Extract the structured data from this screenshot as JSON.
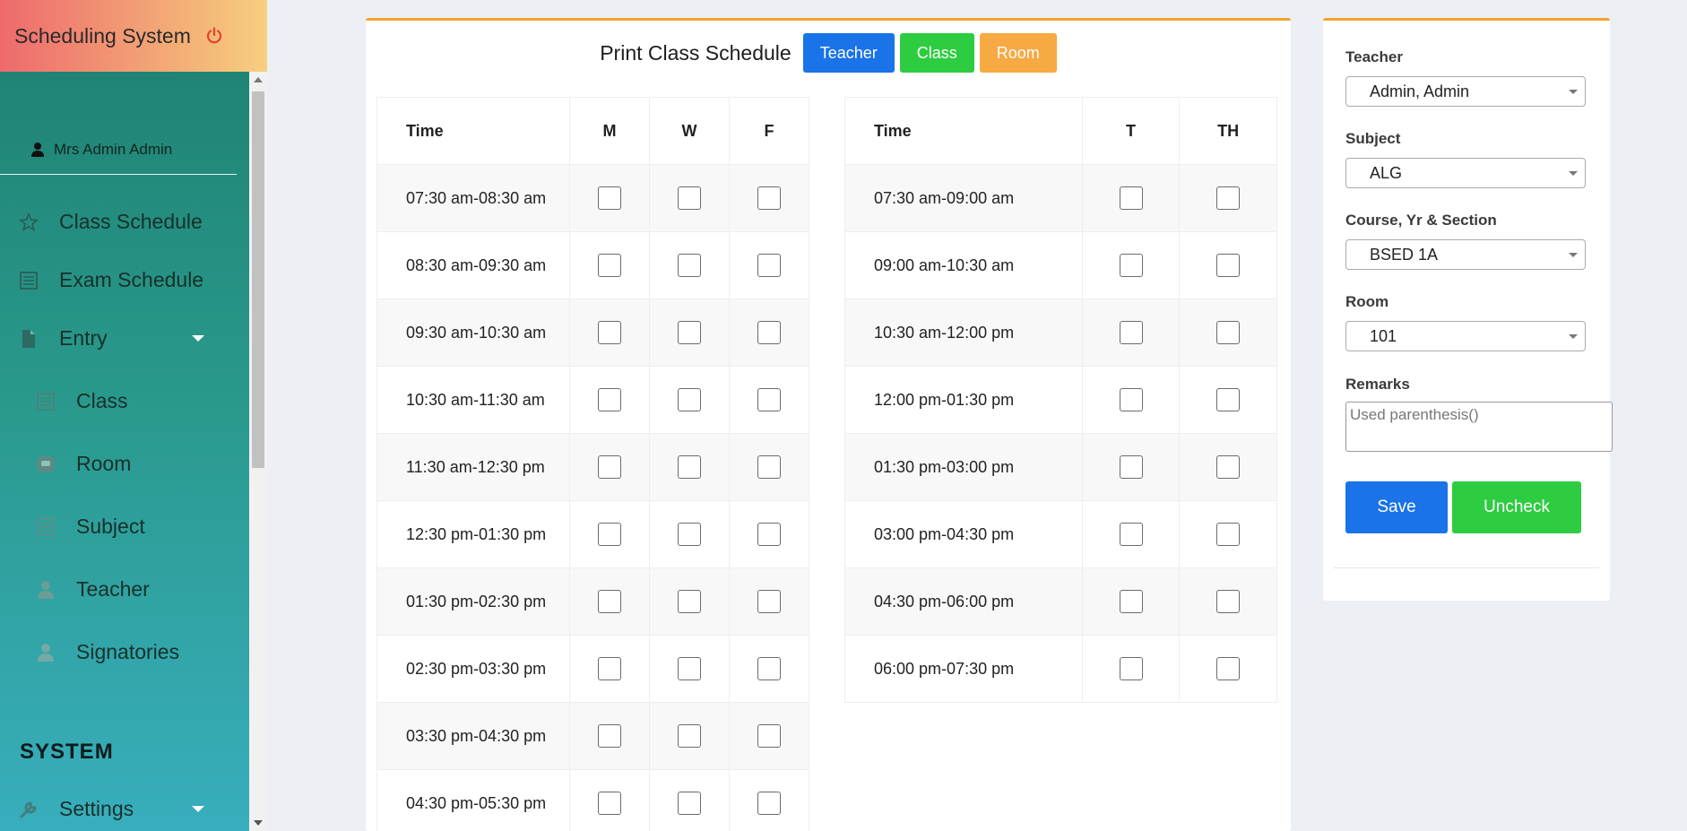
{
  "app": {
    "title": "Scheduling System",
    "accent_header_gradient": [
      "#ee6a6d",
      "#f6cf80"
    ],
    "sidebar_color": "#2a9a8e"
  },
  "sidebar": {
    "user": "Mrs Admin Admin",
    "items": [
      {
        "label": "Class Schedule",
        "icon": "star-icon"
      },
      {
        "label": "Exam Schedule",
        "icon": "list-icon"
      },
      {
        "label": "Entry",
        "icon": "file-icon",
        "has_dropdown": true
      },
      {
        "label": "Class",
        "icon": "list-icon",
        "sub": true
      },
      {
        "label": "Room",
        "icon": "room-icon",
        "sub": true
      },
      {
        "label": "Subject",
        "icon": "list-icon",
        "sub": true
      },
      {
        "label": "Teacher",
        "icon": "user-icon",
        "sub": true
      },
      {
        "label": "Signatories",
        "icon": "user-icon",
        "sub": true
      }
    ],
    "system_heading": "SYSTEM",
    "settings": {
      "label": "Settings",
      "icon": "wrench-icon",
      "has_dropdown": true
    }
  },
  "schedule": {
    "title": "Print Class Schedule",
    "buttons": {
      "teacher": "Teacher",
      "class": "Class",
      "room": "Room"
    },
    "mwf": {
      "headers": [
        "Time",
        "M",
        "W",
        "F"
      ],
      "rows": [
        "07:30 am-08:30 am",
        "08:30 am-09:30 am",
        "09:30 am-10:30 am",
        "10:30 am-11:30 am",
        "11:30 am-12:30 pm",
        "12:30 pm-01:30 pm",
        "01:30 pm-02:30 pm",
        "02:30 pm-03:30 pm",
        "03:30 pm-04:30 pm",
        "04:30 pm-05:30 pm"
      ]
    },
    "tth": {
      "headers": [
        "Time",
        "T",
        "TH"
      ],
      "rows": [
        "07:30 am-09:00 am",
        "09:00 am-10:30 am",
        "10:30 am-12:00 pm",
        "12:00 pm-01:30 pm",
        "01:30 pm-03:00 pm",
        "03:00 pm-04:30 pm",
        "04:30 pm-06:00 pm",
        "06:00 pm-07:30 pm"
      ]
    }
  },
  "form": {
    "teacher_label": "Teacher",
    "teacher_value": "Admin, Admin",
    "subject_label": "Subject",
    "subject_value": "ALG",
    "course_label": "Course, Yr & Section",
    "course_value": "BSED 1A",
    "room_label": "Room",
    "room_value": "101",
    "remarks_label": "Remarks",
    "remarks_placeholder": "Used parenthesis()",
    "save_label": "Save",
    "uncheck_label": "Uncheck"
  }
}
